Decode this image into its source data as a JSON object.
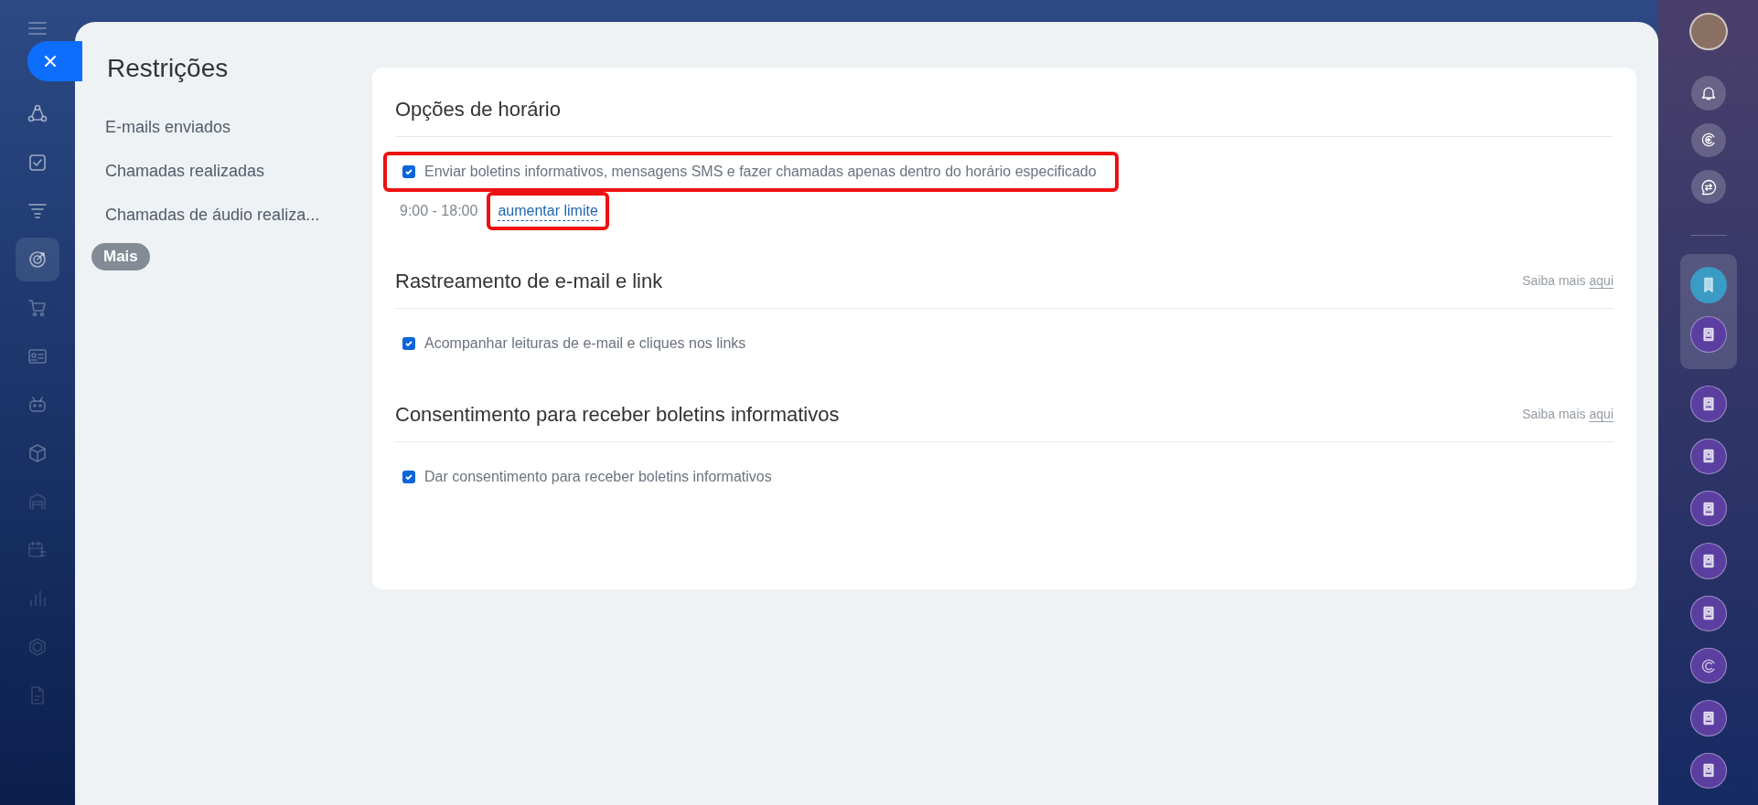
{
  "left_rail": {
    "items": [
      {
        "kind": "nodes",
        "selected": false
      },
      {
        "kind": "task",
        "selected": false
      },
      {
        "kind": "funnel",
        "selected": false
      },
      {
        "kind": "target",
        "selected": true
      },
      {
        "kind": "cart",
        "selected": false
      },
      {
        "kind": "card",
        "selected": false
      },
      {
        "kind": "robot",
        "selected": false
      },
      {
        "kind": "box",
        "selected": false
      },
      {
        "kind": "store",
        "selected": false
      },
      {
        "kind": "calendar",
        "selected": false
      },
      {
        "kind": "chart",
        "selected": false
      },
      {
        "kind": "hexagon",
        "selected": false
      },
      {
        "kind": "document",
        "selected": false
      }
    ]
  },
  "panel": {
    "title": "Restrições",
    "menu": [
      {
        "label": "E-mails enviados",
        "selected": false
      },
      {
        "label": "Chamadas realizadas",
        "selected": false
      },
      {
        "label": "Chamadas de áudio realiza...",
        "selected": false
      }
    ],
    "more_button": "Mais",
    "sections": [
      {
        "title": "Opções de horário",
        "options": [
          {
            "label": "Enviar boletins informativos, mensagens SMS e fazer chamadas apenas dentro do horário especificado",
            "checked": true,
            "highlighted": true
          }
        ],
        "schedule": {
          "hours": "9:00 - 18:00",
          "link": "aumentar limite",
          "highlighted": true
        }
      },
      {
        "title": "Rastreamento de e-mail e link",
        "info": {
          "text": "Saiba mais",
          "link": "aqui"
        },
        "options": [
          {
            "label": "Acompanhar leituras de e-mail e cliques nos links",
            "checked": true,
            "highlighted": false
          }
        ]
      },
      {
        "title": "Consentimento para receber boletins informativos",
        "info": {
          "text": "Saiba mais",
          "link": "aqui"
        },
        "options": [
          {
            "label": "Dar consentimento para receber boletins informativos",
            "checked": true,
            "highlighted": false
          }
        ]
      }
    ]
  },
  "right_rail": {
    "items": [
      {
        "kind": "bell"
      },
      {
        "kind": "spark"
      },
      {
        "kind": "chat"
      },
      {
        "kind": "divider"
      },
      {
        "kind": "bookmark",
        "grouped": true
      },
      {
        "kind": "book",
        "grouped": true
      },
      {
        "kind": "book"
      },
      {
        "kind": "book"
      },
      {
        "kind": "book"
      },
      {
        "kind": "book"
      },
      {
        "kind": "book"
      },
      {
        "kind": "spark-app"
      },
      {
        "kind": "book"
      },
      {
        "kind": "book"
      }
    ]
  }
}
